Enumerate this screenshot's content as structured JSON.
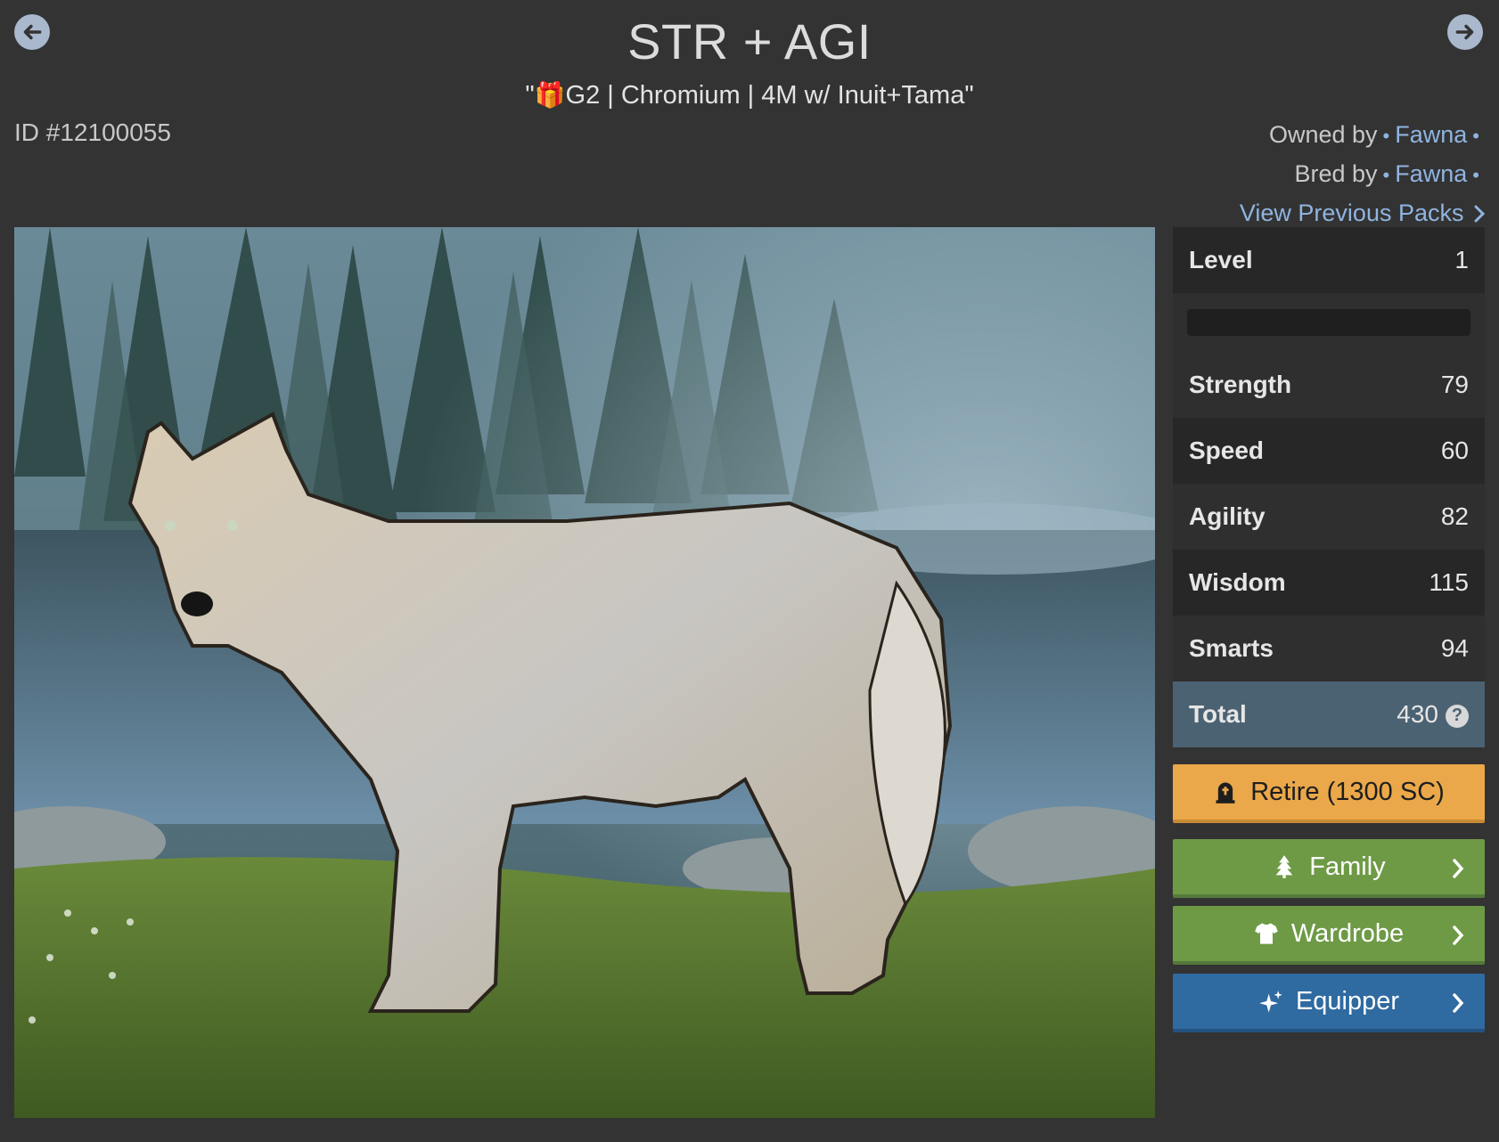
{
  "header": {
    "title": "STR + AGI",
    "subtitle_open": "\"",
    "subtitle_text": "G2 | Chromium | 4M w/ Inuit+Tama\"",
    "wolf_id": "ID #12100055"
  },
  "ownership": {
    "owned_label": "Owned by",
    "owner": "Fawna",
    "bred_label": "Bred by",
    "breeder": "Fawna",
    "previous_packs": "View Previous Packs"
  },
  "stats": {
    "level_label": "Level",
    "level_value": "1",
    "xp_progress": 0,
    "rows": [
      {
        "name": "Strength",
        "value": "79"
      },
      {
        "name": "Speed",
        "value": "60"
      },
      {
        "name": "Agility",
        "value": "82"
      },
      {
        "name": "Wisdom",
        "value": "115"
      },
      {
        "name": "Smarts",
        "value": "94"
      }
    ],
    "total_label": "Total",
    "total_value": "430"
  },
  "actions": {
    "retire": "Retire (1300 SC)",
    "family": "Family",
    "wardrobe": "Wardrobe",
    "equipper": "Equipper"
  },
  "icons": {
    "prev": "arrow-left-circle-icon",
    "next": "arrow-right-circle-icon",
    "gift": "gift-icon",
    "help": "question-circle-icon",
    "retire": "tombstone-icon",
    "family": "tree-icon",
    "wardrobe": "shirt-icon",
    "equipper": "sparkles-icon"
  },
  "colors": {
    "background": "#333333",
    "link": "#8fb4e0",
    "retire": "#eaa84a",
    "family": "#6e9a46",
    "equipper": "#2f6aa0",
    "total_row": "#4b6273"
  }
}
